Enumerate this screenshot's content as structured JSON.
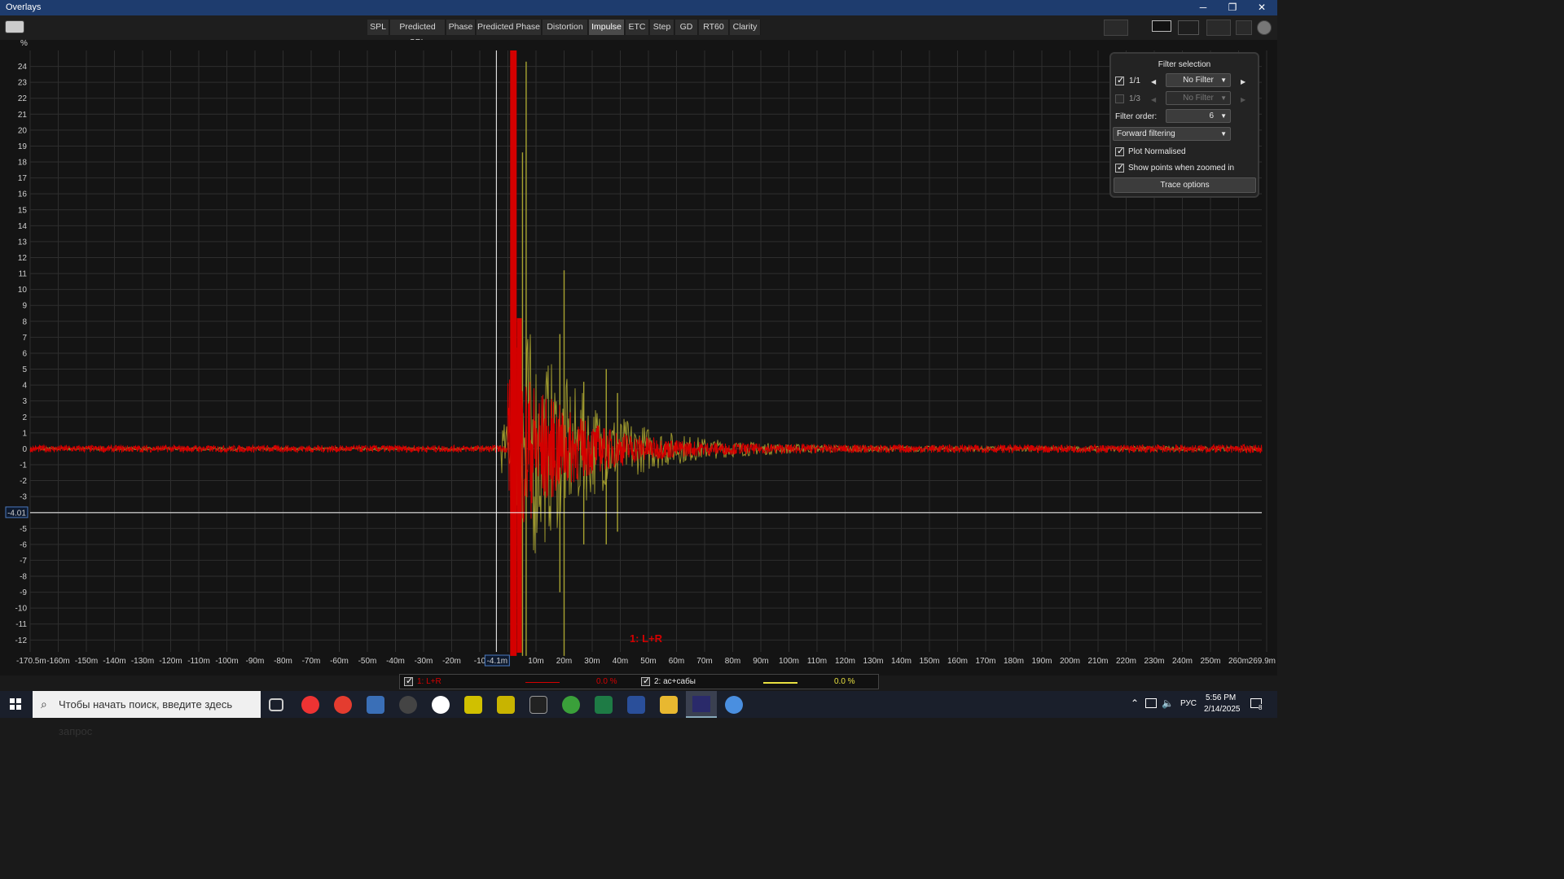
{
  "window": {
    "title": "Overlays",
    "minimize": "─",
    "restore": "❐",
    "close": "✕"
  },
  "tabs": [
    {
      "label": "SPL",
      "active": false
    },
    {
      "label": "Predicted SPL",
      "active": false
    },
    {
      "label": "Phase",
      "active": false
    },
    {
      "label": "Predicted Phase",
      "active": false
    },
    {
      "label": "Distortion",
      "active": false
    },
    {
      "label": "Impulse",
      "active": true
    },
    {
      "label": "ETC",
      "active": false
    },
    {
      "label": "Step",
      "active": false
    },
    {
      "label": "GD",
      "active": false
    },
    {
      "label": "RT60",
      "active": false
    },
    {
      "label": "Clarity",
      "active": false
    }
  ],
  "plot": {
    "y_unit": "%",
    "y_ticks": [
      "24",
      "23",
      "22",
      "21",
      "20",
      "19",
      "18",
      "17",
      "16",
      "15",
      "14",
      "13",
      "12",
      "11",
      "10",
      "9",
      "8",
      "7",
      "6",
      "5",
      "4",
      "3",
      "2",
      "1",
      "0",
      "-1",
      "-2",
      "-3",
      "-4",
      "-5",
      "-6",
      "-7",
      "-8",
      "-9",
      "-10",
      "-11",
      "-12"
    ],
    "x_ticks": [
      "-170.5m",
      "-160m",
      "-150m",
      "-140m",
      "-130m",
      "-120m",
      "-110m",
      "-100m",
      "-90m",
      "-80m",
      "-70m",
      "-60m",
      "-50m",
      "-40m",
      "-30m",
      "-20m",
      "-10",
      "",
      "10m",
      "20m",
      "30m",
      "40m",
      "50m",
      "60m",
      "70m",
      "80m",
      "90m",
      "100m",
      "110m",
      "120m",
      "130m",
      "140m",
      "150m",
      "160m",
      "170m",
      "180m",
      "190m",
      "200m",
      "210m",
      "220m",
      "230m",
      "240m",
      "250m",
      "260m",
      "269.9m"
    ],
    "cursor_x_label": "-4.1m",
    "cursor_y_label": "-4.01",
    "trace_label": "1: L+R",
    "colors": {
      "trace1": "#d40000",
      "trace2": "#a8a330",
      "grid": "#2e2e2e",
      "cursor": "#ffffff"
    }
  },
  "filter_panel": {
    "title": "Filter selection",
    "row1": {
      "checked": true,
      "label": "1/1",
      "value": "No Filter"
    },
    "row2": {
      "checked": false,
      "label": "1/3",
      "value": "No Filter"
    },
    "order_label": "Filter order:",
    "order_value": "6",
    "filtering": "Forward filtering",
    "plot_normalised": "Plot Normalised",
    "show_points": "Show points when zoomed in",
    "trace_options": "Trace options"
  },
  "legend": {
    "t1_name": "1: L+R",
    "t1_value": "0.0 %",
    "t2_name": "2: ас+сабы",
    "t2_value": "0.0 %"
  },
  "taskbar": {
    "search_placeholder": "Чтобы начать поиск, введите здесь запрос",
    "lang": "РУС",
    "time": "5:56 PM",
    "date": "2/14/2025",
    "notif_count": "8"
  }
}
